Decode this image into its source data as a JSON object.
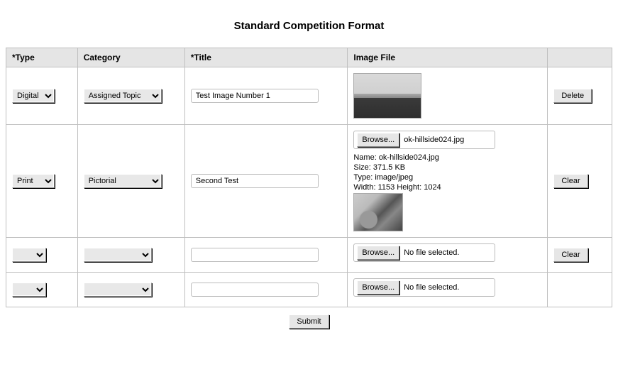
{
  "heading": "Standard Competition Format",
  "columns": {
    "type": "*Type",
    "category": "Category",
    "title": "*Title",
    "image": "Image File",
    "action": ""
  },
  "rows": [
    {
      "type_value": "Digital",
      "category_value": "Assigned Topic",
      "title_value": "Test Image Number 1",
      "image_mode": "thumb_landscape",
      "action_label": "Delete"
    },
    {
      "type_value": "Print",
      "category_value": "Pictorial",
      "title_value": "Second Test",
      "image_mode": "file_with_meta",
      "browse_label": "Browse...",
      "filename": "ok-hillside024.jpg",
      "meta_name": "Name: ok-hillside024.jpg",
      "meta_size": "Size: 371.5 KB",
      "meta_type": "Type: image/jpeg",
      "meta_dims": "Width: 1153 Height: 1024",
      "action_label": "Clear"
    },
    {
      "type_value": "",
      "category_value": "",
      "title_value": "",
      "image_mode": "file_empty",
      "browse_label": "Browse...",
      "filename": "No file selected.",
      "action_label": "Clear"
    },
    {
      "type_value": "",
      "category_value": "",
      "title_value": "",
      "image_mode": "file_empty",
      "browse_label": "Browse...",
      "filename": "No file selected.",
      "action_label": ""
    }
  ],
  "submit_label": "Submit"
}
